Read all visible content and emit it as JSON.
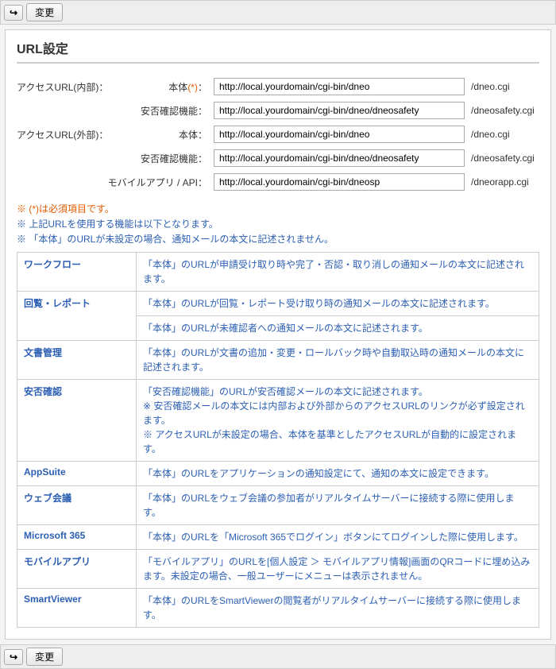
{
  "toolbar": {
    "back_icon": "↩",
    "change_label": "変更"
  },
  "title": "URL設定",
  "form": {
    "internal_label": "アクセスURL(内部)：",
    "external_label": "アクセスURL(外部)：",
    "mobile_label": "モバイルアプリ / API：",
    "body_label": "本体",
    "body_req": "(*)",
    "colon": "：",
    "safety_label": "安否確認機能：",
    "internal_body_value": "http://local.yourdomain/cgi-bin/dneo",
    "internal_body_suffix": "/dneo.cgi",
    "internal_safety_value": "http://local.yourdomain/cgi-bin/dneo/dneosafety",
    "internal_safety_suffix": "/dneosafety.cgi",
    "external_body_value": "http://local.yourdomain/cgi-bin/dneo",
    "external_body_suffix": "/dneo.cgi",
    "external_safety_value": "http://local.yourdomain/cgi-bin/dneo/dneosafety",
    "external_safety_suffix": "/dneosafety.cgi",
    "mobile_value": "http://local.yourdomain/cgi-bin/dneosp",
    "mobile_suffix": "/dneorapp.cgi"
  },
  "notes": {
    "required": "※ (*)は必須項目です。",
    "line2": "※ 上記URLを使用する機能は以下となります。",
    "line3": "※ 「本体」のURLが未設定の場合、通知メールの本文に記述されません。"
  },
  "info_rows": [
    {
      "cat": "ワークフロー",
      "desc": [
        "「本体」のURLが申請受け取り時や完了・否認・取り消しの通知メールの本文に記述されます。"
      ],
      "rowspan": 1
    },
    {
      "cat": "回覧・レポート",
      "desc": [
        "「本体」のURLが回覧・レポート受け取り時の通知メールの本文に記述されます。",
        "「本体」のURLが未確認者への通知メールの本文に記述されます。"
      ],
      "rowspan": 2
    },
    {
      "cat": "文書管理",
      "desc": [
        "「本体」のURLが文書の追加・変更・ロールバック時や自動取込時の通知メールの本文に記述されます。"
      ],
      "rowspan": 1
    },
    {
      "cat": "安否確認",
      "desc": [
        "「安否確認機能」のURLが安否確認メールの本文に記述されます。\n※ 安否確認メールの本文には内部および外部からのアクセスURLのリンクが必ず設定されます。\n※ アクセスURLが未設定の場合、本体を基準としたアクセスURLが自動的に設定されます。"
      ],
      "rowspan": 1
    },
    {
      "cat": "AppSuite",
      "desc": [
        "「本体」のURLをアプリケーションの通知設定にて、通知の本文に設定できます。"
      ],
      "rowspan": 1
    },
    {
      "cat": "ウェブ会議",
      "desc": [
        "「本体」のURLをウェブ会議の参加者がリアルタイムサーバーに接続する際に使用します。"
      ],
      "rowspan": 1
    },
    {
      "cat": "Microsoft 365",
      "desc": [
        "「本体」のURLを「Microsoft 365でログイン」ボタンにてログインした際に使用します。"
      ],
      "rowspan": 1
    },
    {
      "cat": "モバイルアプリ",
      "desc": [
        "「モバイルアプリ」のURLを[個人設定 ＞ モバイルアプリ情報]画面のQRコードに埋め込みます。未設定の場合、一般ユーザーにメニューは表示されません。"
      ],
      "rowspan": 1
    },
    {
      "cat": "SmartViewer",
      "desc": [
        "「本体」のURLをSmartViewerの閲覧者がリアルタイムサーバーに接続する際に使用します。"
      ],
      "rowspan": 1
    }
  ]
}
